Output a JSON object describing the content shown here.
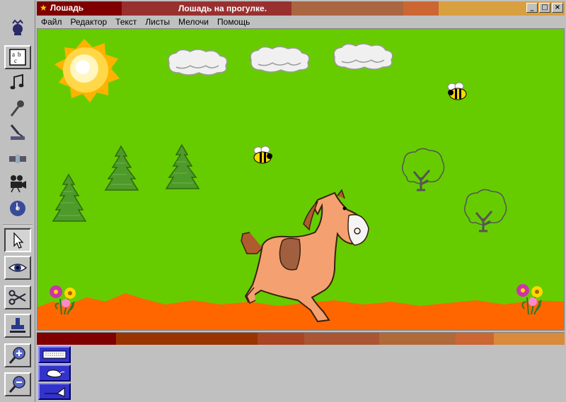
{
  "window": {
    "app_title": "Лошадь",
    "document_title": "Лошадь на прогулке.",
    "controls": {
      "minimize": "_",
      "maximize": "□",
      "close": "×"
    }
  },
  "menu": {
    "items": [
      "Файл",
      "Редактор",
      "Текст",
      "Листы",
      "Мелочи",
      "Помощь"
    ]
  },
  "toolbar": {
    "tools": [
      "character-icon",
      "text-letters-icon",
      "music-note-icon",
      "microphone-icon",
      "scanner-icon",
      "filmstrip-icon",
      "movie-camera-icon",
      "cd-music-icon",
      "pointer-arrow-icon",
      "eye-icon",
      "scissors-icon",
      "stamp-icon",
      "zoom-in-icon",
      "zoom-out-icon"
    ],
    "selected_tool": "pointer-arrow-icon"
  },
  "palette": {
    "colors": [
      "#800000",
      "#993300",
      "#aa4422",
      "#aa5533",
      "#b06a3a",
      "#cc6633",
      "#d98a3a"
    ]
  },
  "scene": {
    "background_color": "#66cc00",
    "ground_color": "#ff6600",
    "objects": [
      "sun",
      "cloud",
      "cloud",
      "cloud",
      "bee",
      "bee",
      "pine-tree",
      "pine-tree",
      "pine-tree",
      "oak-tree",
      "oak-tree",
      "horse",
      "flowers",
      "flowers"
    ]
  },
  "bottom_panel": {
    "buttons": [
      "keyboard-icon",
      "mouse-icon",
      "trumpet-icon"
    ]
  }
}
